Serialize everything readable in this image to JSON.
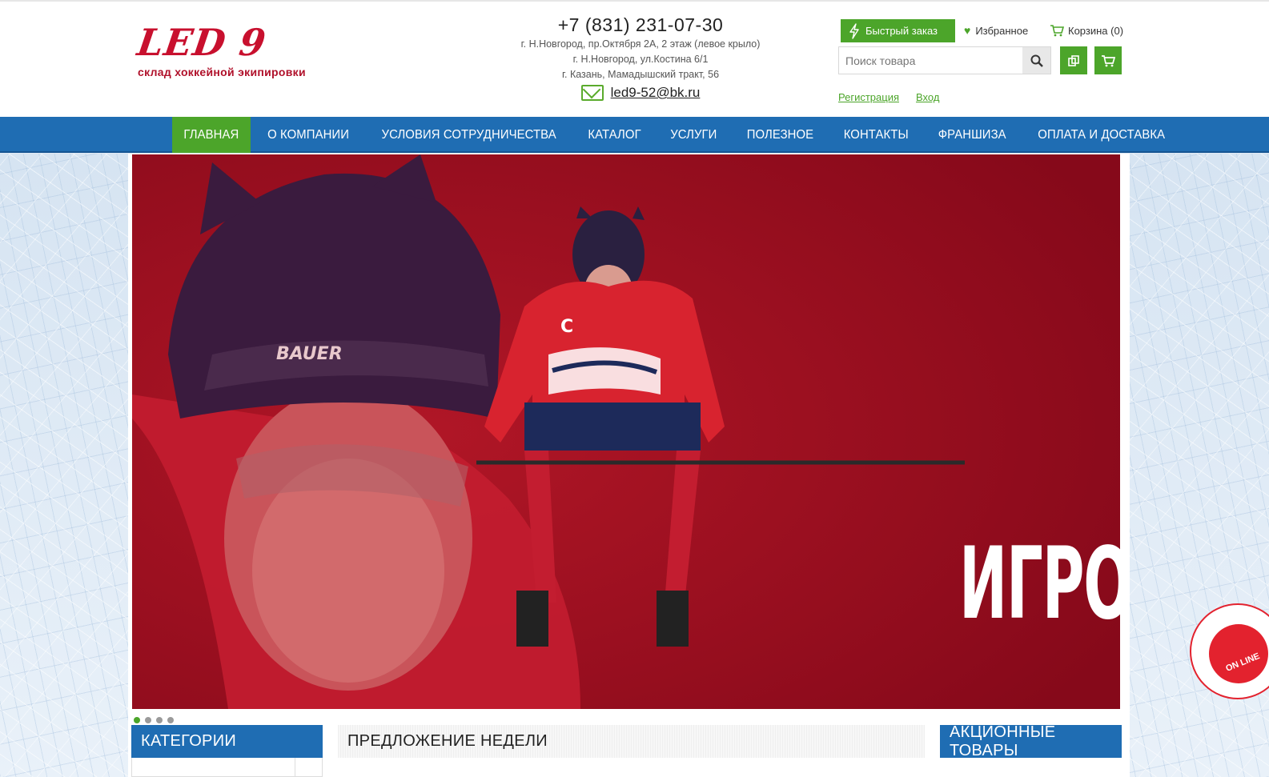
{
  "logo": {
    "main": "LED 9",
    "tagline": "склад хоккейной экипировки"
  },
  "contacts": {
    "phone": "+7 (831) 231-07-30",
    "addresses": [
      "г. Н.Новгород, пр.Октября 2А, 2 этаж (левое крыло)",
      "г. Н.Новгород, ул.Костина 6/1",
      "г. Казань, Мамадышский тракт, 56"
    ],
    "email": "led9-52@bk.ru"
  },
  "header_actions": {
    "quick_order": "Быстрый заказ",
    "favorites": "Избранное",
    "cart": "Корзина (0)",
    "search_placeholder": "Поиск товара",
    "register": "Регистрация",
    "login": "Вход"
  },
  "nav": {
    "items": [
      "ГЛАВНАЯ",
      "О КОМПАНИИ",
      "УСЛОВИЯ СОТРУДНИЧЕСТВА",
      "КАТАЛОГ",
      "УСЛУГИ",
      "ПОЛЕЗНОЕ",
      "КОНТАКТЫ",
      "ФРАНШИЗА",
      "ОПЛАТА И ДОСТАВКА"
    ],
    "active_index": 0
  },
  "banner": {
    "word": "ИГРОК",
    "helmet_brand": "BAUER",
    "captain_letter": "C",
    "slide_count": 4,
    "active_slide": 1
  },
  "sections": {
    "categories": "КАТЕГОРИИ",
    "offer": "ПРЕДЛОЖЕНИЕ НЕДЕЛИ",
    "promo": "АКЦИОННЫЕ ТОВАРЫ"
  },
  "widget": {
    "label": "ON LINE"
  },
  "colors": {
    "brand_red": "#c8102e",
    "nav_blue": "#1f6db3",
    "accent_green": "#4ca52a",
    "banner_red": "#8e0c1d"
  },
  "icons": [
    "bolt-icon",
    "heart-icon",
    "cart-icon",
    "search-icon",
    "compare-icon",
    "cart-button-icon",
    "mail-icon",
    "chat-icon"
  ]
}
